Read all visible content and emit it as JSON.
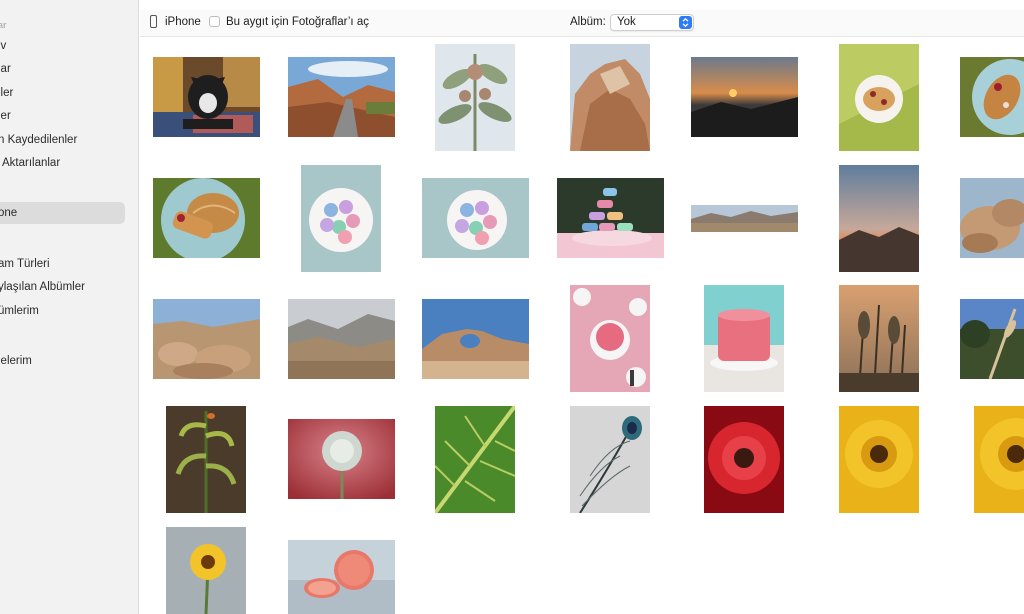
{
  "sidebar": {
    "section_header": "ar",
    "items": [
      {
        "label": "iv"
      },
      {
        "label": "lar"
      },
      {
        "label": "iler"
      },
      {
        "label": "ler"
      },
      {
        "label": "n Kaydedilenler"
      },
      {
        "label": "Aktarılanlar"
      },
      {
        "label": "one",
        "selected": true
      },
      {
        "label": "am Türleri"
      },
      {
        "label": "ylaşılan Albümler"
      },
      {
        "label": "ümlerim"
      },
      {
        "label": "jelerim"
      }
    ]
  },
  "toolbar": {
    "device_icon": "iphone-icon",
    "device_name": "iPhone",
    "open_photos_label": "Bu aygıt için Fotoğraflar’ı aç",
    "open_photos_checked": false,
    "album_label": "Albüm:",
    "album_value": "Yok",
    "accent_color": "#2f7cf6"
  },
  "photos": [
    {
      "subject": "dog"
    },
    {
      "subject": "canyon-road"
    },
    {
      "subject": "succulent"
    },
    {
      "subject": "rock-cliff"
    },
    {
      "subject": "sunset-sea"
    },
    {
      "subject": "pastry-plate-green"
    },
    {
      "subject": "pastry-plate-blue"
    },
    {
      "subject": "concha-plate"
    },
    {
      "subject": "macarons-plate-top"
    },
    {
      "subject": "macarons-plate"
    },
    {
      "subject": "macaron-tower"
    },
    {
      "subject": "mountain-panorama"
    },
    {
      "subject": "dusk-mountains"
    },
    {
      "subject": "boulders"
    },
    {
      "subject": "desert-rocks"
    },
    {
      "subject": "valley-mountains"
    },
    {
      "subject": "rock-arch"
    },
    {
      "subject": "cake-table"
    },
    {
      "subject": "pink-cake"
    },
    {
      "subject": "dry-grass"
    },
    {
      "subject": "palms-sky"
    },
    {
      "subject": "aloe-flower"
    },
    {
      "subject": "allium"
    },
    {
      "subject": "green-leaf"
    },
    {
      "subject": "peacock-feather"
    },
    {
      "subject": "red-gerbera"
    },
    {
      "subject": "yellow-gerbera"
    },
    {
      "subject": "yellow-gerbera-2"
    },
    {
      "subject": "yellow-daisy-stem"
    },
    {
      "subject": "grapefruit"
    }
  ]
}
